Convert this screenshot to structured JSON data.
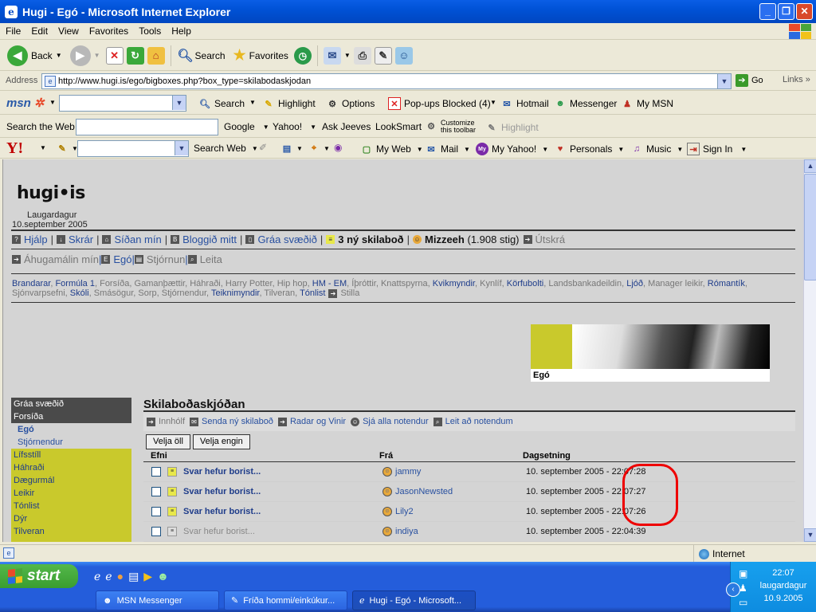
{
  "window": {
    "title": "Hugi - Egó - Microsoft Internet Explorer"
  },
  "menu": [
    "File",
    "Edit",
    "View",
    "Favorites",
    "Tools",
    "Help"
  ],
  "toolbar": {
    "back": "Back",
    "search": "Search",
    "favorites": "Favorites"
  },
  "address": {
    "label": "Address",
    "url": "http://www.hugi.is/ego/bigboxes.php?box_type=skilabodaskjodan",
    "go": "Go",
    "links": "Links"
  },
  "msnbar": {
    "search": "Search",
    "highlight": "Highlight",
    "options": "Options",
    "popups": "Pop-ups Blocked (4)",
    "hotmail": "Hotmail",
    "messenger": "Messenger",
    "mymsn": "My MSN"
  },
  "searchweb": {
    "label": "Search the Web",
    "google": "Google",
    "yahoo": "Yahoo!",
    "askjeeves": "Ask Jeeves",
    "looksmart": "LookSmart",
    "customize1": "Customize",
    "customize2": "this toolbar",
    "highlight": "Highlight"
  },
  "yahoobar": {
    "searchweb": "Search Web",
    "myweb": "My Web",
    "mail": "Mail",
    "myyahoo": "My Yahoo!",
    "personals": "Personals",
    "music": "Music",
    "signin": "Sign In"
  },
  "page": {
    "logo": "hugi•is",
    "day": "Laugardagur",
    "date": "10.september 2005",
    "nav1": {
      "help": "Hjálp",
      "files": "Skrár",
      "mypage": "Síðan mín",
      "blog": "Bloggið mitt",
      "gray": "Gráa svæðið",
      "messages": "3 ný skilaboð",
      "user": "Mizzeeh",
      "stig": "(1.908 stig)",
      "logout": "Útskrá"
    },
    "nav2": {
      "interests": "Áhugamálin mín",
      "ego": "Egó",
      "admin": "Stjórnun",
      "search": "Leita"
    },
    "interests": [
      {
        "t": "Brandarar",
        "b": true
      },
      {
        "t": "Formúla 1",
        "b": true
      },
      {
        "t": "Forsíða",
        "b": false
      },
      {
        "t": "Gamanþættir",
        "b": false
      },
      {
        "t": "Háhraði",
        "b": false
      },
      {
        "t": "Harry Potter",
        "b": false
      },
      {
        "t": "Hip hop",
        "b": false
      },
      {
        "t": "HM - EM",
        "b": true
      },
      {
        "t": "Íþróttir",
        "b": false
      },
      {
        "t": "Knattspyrna",
        "b": false
      },
      {
        "t": "Kvikmyndir",
        "b": true
      },
      {
        "t": "Kynlíf",
        "b": false
      },
      {
        "t": "Körfubolti",
        "b": true
      },
      {
        "t": "Landsbankadeildin",
        "b": false
      },
      {
        "t": "Ljóð",
        "b": true
      },
      {
        "t": "Manager leikir",
        "b": false
      },
      {
        "t": "Rómantík",
        "b": true
      },
      {
        "t": "Sjónvarpsefni",
        "b": false
      },
      {
        "t": "Skóli",
        "b": true
      },
      {
        "t": "Smásögur",
        "b": false
      },
      {
        "t": "Sorp",
        "b": false
      },
      {
        "t": "Stjórnendur",
        "b": false
      },
      {
        "t": "Teiknimyndir",
        "b": true
      },
      {
        "t": "Tilveran",
        "b": false
      },
      {
        "t": "Tónlist",
        "b": true
      }
    ],
    "settings": "Stilla",
    "banner_caption": "Egó",
    "sidebar": {
      "head1": "Gráa svæðið",
      "head2": "Forsíða",
      "items": [
        {
          "label": "Egó",
          "current": true
        },
        {
          "label": "Stjórnendur",
          "current": false
        }
      ],
      "yellow": [
        "Lífsstíll",
        "Háhraði",
        "Dægurmál",
        "Leikir",
        "Tónlist",
        "Dýr",
        "Tilveran"
      ]
    },
    "main": {
      "title": "Skilaboðaskjóðan",
      "subnav": {
        "inbox": "Innhólf",
        "send": "Senda ný skilaboð",
        "radar": "Radar og Vinir",
        "seeall": "Sjá alla notendur",
        "searchusers": "Leit að notendum"
      },
      "select_all": "Velja öll",
      "select_none": "Velja engin",
      "cols": {
        "subject": "Efni",
        "from": "Frá",
        "date": "Dagsetning"
      },
      "rows": [
        {
          "subject": "Svar hefur borist...",
          "from": "jammy",
          "date": "10. september 2005 - 22:07:28",
          "unread": true
        },
        {
          "subject": "Svar hefur borist...",
          "from": "JasonNewsted",
          "date": "10. september 2005 - 22:07:27",
          "unread": true
        },
        {
          "subject": "Svar hefur borist...",
          "from": "Lily2",
          "date": "10. september 2005 - 22:07:26",
          "unread": true
        },
        {
          "subject": "Svar hefur borist...",
          "from": "indiya",
          "date": "10. september 2005 - 22:04:39",
          "unread": false
        }
      ]
    }
  },
  "status": {
    "zone": "Internet"
  },
  "taskbar": {
    "start": "start",
    "tasks": [
      "MSN Messenger",
      "Fríða hommi/einkúkur...",
      "Hugi - Egó - Microsoft..."
    ],
    "time": "22:07",
    "day": "laugardagur",
    "date": "10.9.2005"
  }
}
